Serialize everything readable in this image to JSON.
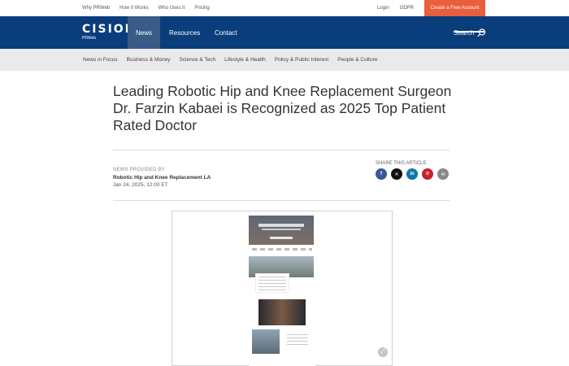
{
  "topbar": {
    "links": [
      "Why PRWeb",
      "How It Works",
      "Who Uses It",
      "Pricing"
    ],
    "login": "Login",
    "gdpr": "GDPR",
    "cta": "Create a Free Account"
  },
  "nav": {
    "logo_mark": "CISION",
    "logo_sub": "PRWeb",
    "news": "News",
    "resources": "Resources",
    "contact": "Contact",
    "search": "Search"
  },
  "categories": [
    "News in Focus",
    "Business & Money",
    "Science & Tech",
    "Lifestyle & Health",
    "Policy & Public Interest",
    "People & Culture"
  ],
  "article": {
    "headline": "Leading Robotic Hip and Knee Replacement Surgeon Dr. Farzin Kabaei is Recognized as 2025 Top Patient Rated Doctor",
    "provided_label": "NEWS PROVIDED BY",
    "organization": "Robotic Hip and Knee Replacement LA",
    "date": "Jan 24, 2025, 12:00 ET",
    "share_label": "SHARE THIS ARTICLE"
  },
  "share_buttons": [
    {
      "name": "facebook-share-icon",
      "glyph": "f",
      "color": "#3b5998"
    },
    {
      "name": "x-share-icon",
      "glyph": "✕",
      "color": "#111111"
    },
    {
      "name": "linkedin-share-icon",
      "glyph": "in",
      "color": "#0e76a8"
    },
    {
      "name": "pinterest-share-icon",
      "glyph": "℗",
      "color": "#c8232c"
    },
    {
      "name": "email-share-icon",
      "glyph": "✉",
      "color": "#888888"
    }
  ],
  "colors": {
    "nav_bg": "#0a3d7c",
    "cta_bg": "#e95e3c",
    "catbar_bg": "#eaeaea"
  }
}
